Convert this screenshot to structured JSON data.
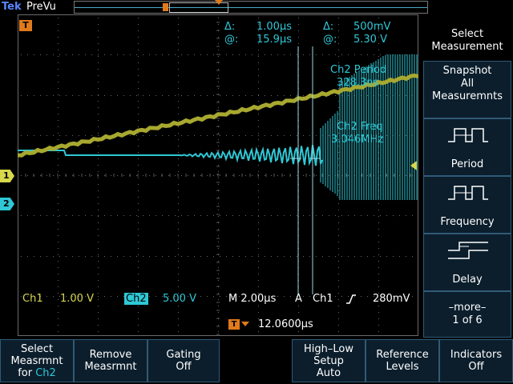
{
  "header": {
    "brand": "Tek",
    "mode": "PreVu"
  },
  "cursor_readout": {
    "delta_time": "1.00µs",
    "at_time": "15.9µs",
    "delta_volt": "500mV",
    "at_volt": "5.30 V",
    "delta_symbol": "Δ:",
    "at_symbol": "@:"
  },
  "measurements": {
    "period_label": "Ch2 Period",
    "period_value": "328.3ns",
    "freq_label": "Ch2 Freq",
    "freq_value": "3.046MHz"
  },
  "status": {
    "ch1_label": "Ch1",
    "ch1_scale": "1.00 V",
    "ch2_label": "Ch2",
    "ch2_scale": "5.00 V",
    "timebase": "M 2.00µs",
    "trigger_mode": "A",
    "trigger_source": "Ch1",
    "trigger_level": "280mV",
    "trigger_position": "12.0600µs"
  },
  "channel_markers": {
    "ch1": "1",
    "ch2": "2",
    "trigger": "T"
  },
  "side_menu": {
    "select_measurement_line1": "Select",
    "select_measurement_line2": "Measurement",
    "snapshot_line1": "Snapshot",
    "snapshot_line2": "All",
    "snapshot_line3": "Measuremnts",
    "period": "Period",
    "frequency": "Frequency",
    "delay": "Delay",
    "more_line1": "–more–",
    "more_line2": "1 of 6"
  },
  "bottom_menu": {
    "select_line1": "Select",
    "select_line2": "Measrmnt",
    "select_line3_pre": "for",
    "select_line3_ch": "Ch2",
    "remove_line1": "Remove",
    "remove_line2": "Measrmnt",
    "gating_line1": "Gating",
    "gating_line2": "Off",
    "highlow_line1": "High–Low",
    "highlow_line2": "Setup",
    "highlow_line3": "Auto",
    "reference_line1": "Reference",
    "reference_line2": "Levels",
    "indicators_line1": "Indicators",
    "indicators_line2": "Off"
  },
  "colors": {
    "ch1": "#d8d84c",
    "ch2": "#2fc8d6",
    "trigger": "#e07a1a",
    "button_bg": "#0c1e2c",
    "grid": "#5a5a5a"
  }
}
